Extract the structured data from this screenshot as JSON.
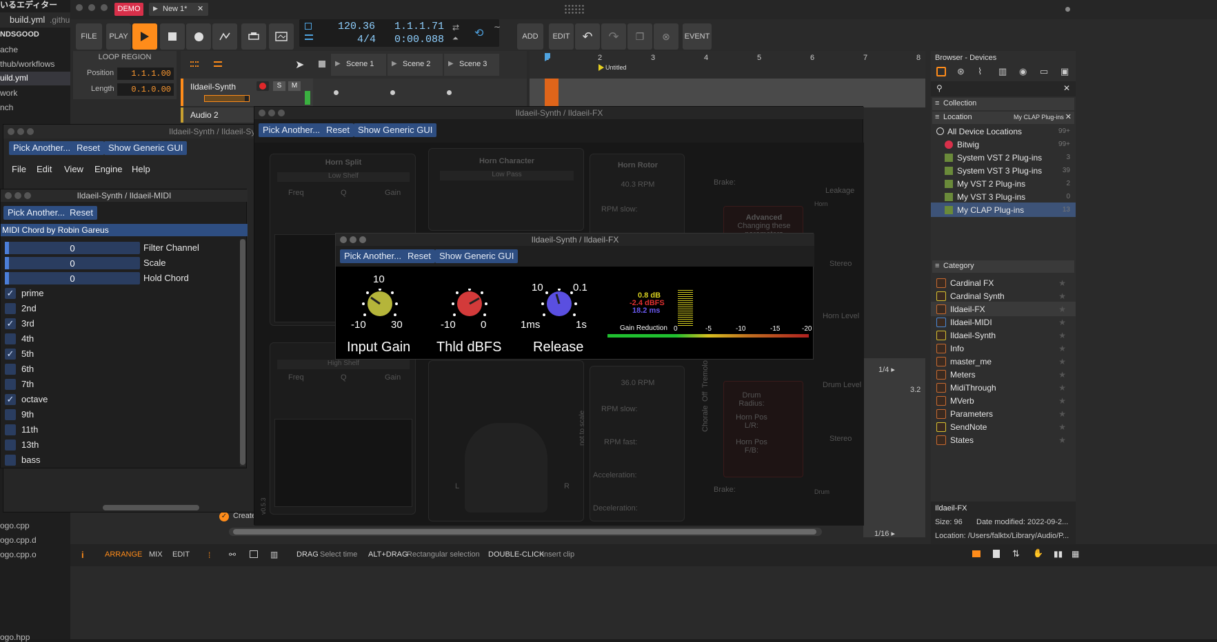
{
  "left_edge": {
    "title": "いるエディター",
    "file": "build.yml",
    "file_dir": ".githu",
    "items": [
      "NDSGOOD",
      "ache",
      "thub/workflows",
      "uild.yml",
      "work",
      "nch"
    ],
    "bottom_files": [
      "ogo.cpp",
      "ogo.cpp.d",
      "ogo.cpp.o",
      "ogo.hpp"
    ]
  },
  "titlebar": {
    "demo": "DEMO",
    "project_tab": "New 1*",
    "play_glyph": "▶",
    "close_glyph": "✕"
  },
  "toolbar": {
    "file": "FILE",
    "play": "PLAY",
    "tempo": "120.36",
    "signature": "4/4",
    "position": "1.1.1.71",
    "time": "0:00.088",
    "add": "ADD",
    "edit": "EDIT",
    "event": "EVENT"
  },
  "loop_region": {
    "title": "LOOP REGION",
    "position_label": "Position",
    "position": "1.1.1.00",
    "length_label": "Length",
    "length": "0.1.0.00"
  },
  "tracks": [
    {
      "name": "Ildaeil-Synth"
    },
    {
      "name": "Audio 2"
    }
  ],
  "track_buttons": {
    "solo": "S",
    "mute": "M"
  },
  "scenes": [
    "Scene 1",
    "Scene 2",
    "Scene 3"
  ],
  "ruler": {
    "marks": [
      "1",
      "2",
      "3",
      "4",
      "5",
      "6",
      "7",
      "8"
    ],
    "marker": "Untitled"
  },
  "arranger": {
    "quant1": "1/4 ▸",
    "quant2": "1/16 ▸",
    "zoom": "3.2",
    "create_label": "Create"
  },
  "generic": {
    "pick": "Pick Another...",
    "reset": "Reset",
    "generic_gui": "Show Generic GUI"
  },
  "window_synth": {
    "title": "Ildaeil-Synth / Ildaeil-Sy",
    "menu": [
      "File",
      "Edit",
      "View",
      "Engine",
      "Help"
    ]
  },
  "window_midi": {
    "title": "Ildaeil-Synth / Ildaeil-MIDI",
    "plugin_name": "MIDI Chord by Robin Gareus",
    "sliders": [
      {
        "value": "0",
        "label": "Filter Channel"
      },
      {
        "value": "0",
        "label": "Scale"
      },
      {
        "value": "0",
        "label": "Hold Chord"
      }
    ],
    "checks": [
      {
        "label": "prime",
        "checked": true
      },
      {
        "label": "2nd",
        "checked": false
      },
      {
        "label": "3rd",
        "checked": true
      },
      {
        "label": "4th",
        "checked": false
      },
      {
        "label": "5th",
        "checked": true
      },
      {
        "label": "6th",
        "checked": false
      },
      {
        "label": "7th",
        "checked": false
      },
      {
        "label": "octave",
        "checked": true
      },
      {
        "label": "9th",
        "checked": false
      },
      {
        "label": "11th",
        "checked": false
      },
      {
        "label": "13th",
        "checked": false
      },
      {
        "label": "bass",
        "checked": false
      }
    ]
  },
  "window_fx_big": {
    "title": "Ildaeil-Synth / Ildaeil-FX",
    "horn_split": "Horn Split",
    "horn_split_filter": "Low Shelf",
    "horn_character": "Horn Character",
    "horn_character_filter": "Low Pass",
    "horn_rotor": "Horn Rotor",
    "rpm": "40.3 RPM",
    "rpm_slow": "RPM slow:",
    "brake": "Brake:",
    "leakage": "Leakage",
    "stereo": "Stereo",
    "horn": "Horn",
    "horn_level": "Horn Level",
    "drum_level": "Drum Level",
    "drum": "Drum",
    "advanced": "Advanced",
    "advanced_sub": "Changing these",
    "advanced_sub2": "parameters",
    "freq": "Freq",
    "q": "Q",
    "gain": "Gain",
    "drum_split_filter": "High Shelf",
    "drum_rpm": "36.0 RPM",
    "rpm_fast": "RPM fast:",
    "acceleration": "Acceleration:",
    "deceleration": "Deceleration:",
    "drum_radius": "Drum Radius:",
    "horn_pos_lr": "Horn Pos L/R:",
    "horn_pos_fb": "Horn Pos F/B:",
    "chorale": "Chorale",
    "off": "Off",
    "tremolo": "Tremolo",
    "not_to_scale": "not to scale",
    "L": "L",
    "R": "R",
    "version": "v0.5.3"
  },
  "window_fx_small": {
    "title": "Ildaeil-Synth / Ildaeil-FX",
    "knobs": [
      {
        "name": "Input Gain",
        "top": "10",
        "min": "-10",
        "max": "30",
        "color": "#b5b53a"
      },
      {
        "name": "Thld dBFS",
        "top": "",
        "min": "-10",
        "max": "0",
        "color": "#d33a3a"
      },
      {
        "name": "Release",
        "top": "10",
        "topright": "0.1",
        "min": "1ms",
        "max": "1s",
        "color": "#5a4fe0"
      }
    ],
    "readout": {
      "a": "0.8 dB",
      "b": "-2.4 dBFS",
      "c": "18.2 ms"
    },
    "gr_label": "Gain Reduction",
    "gr_ticks": [
      "0",
      "-5",
      "-10",
      "-15",
      "-20"
    ]
  },
  "browser": {
    "title": "Browser - Devices",
    "collection": "Collection",
    "location": "Location",
    "location_value": "My CLAP Plug-ins",
    "locations": [
      {
        "name": "All Device Locations",
        "count": "99+"
      },
      {
        "name": "Bitwig",
        "count": "99+"
      },
      {
        "name": "System VST 2 Plug-ins",
        "count": "3"
      },
      {
        "name": "System VST 3 Plug-ins",
        "count": "39"
      },
      {
        "name": "My VST 2 Plug-ins",
        "count": "2"
      },
      {
        "name": "My VST 3 Plug-ins",
        "count": "0"
      },
      {
        "name": "My CLAP Plug-ins",
        "count": "13"
      }
    ],
    "category": "Category",
    "devices": [
      "Cardinal FX",
      "Cardinal Synth",
      "Ildaeil-FX",
      "Ildaeil-MIDI",
      "Ildaeil-Synth",
      "Info",
      "master_me",
      "Meters",
      "MidiThrough",
      "MVerb",
      "Parameters",
      "SendNote",
      "States"
    ],
    "selected_device": "Ildaeil-FX",
    "footer": {
      "name": "Ildaeil-FX",
      "size": "Size: 96",
      "date": "Date modified: 2022-09-2...",
      "location": "Location: /Users/falktx/Library/Audio/P..."
    }
  },
  "statusbar": {
    "info_glyph": "i",
    "arrange": "ARRANGE",
    "mix": "MIX",
    "edit": "EDIT",
    "hints": [
      {
        "key": "DRAG",
        "text": "Select time"
      },
      {
        "key": "ALT+DRAG",
        "text": "Rectangular selection"
      },
      {
        "key": "DOUBLE-CLICK",
        "text": "Insert clip"
      }
    ]
  },
  "colors": {
    "accent": "#ff8c1a",
    "select_blue": "#2e4e82",
    "record": "#e0282a"
  }
}
